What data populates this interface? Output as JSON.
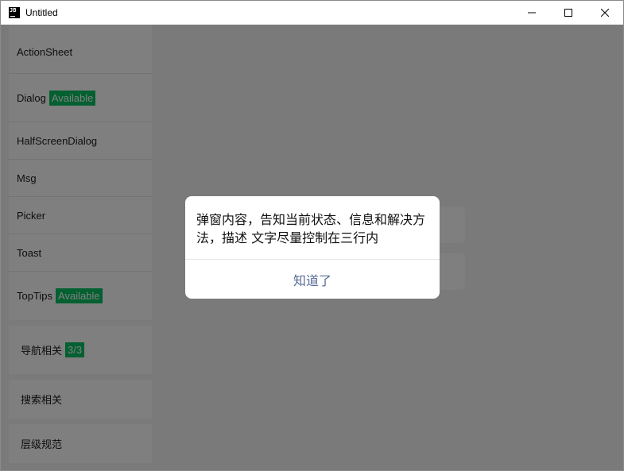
{
  "window": {
    "title": "Untitled",
    "app_icon_text": "JB"
  },
  "controls": {
    "minimize": "minimize-icon",
    "maximize": "maximize-icon",
    "close": "close-icon"
  },
  "sidebar": {
    "items": [
      {
        "label": "ActionSheet",
        "badge": ""
      },
      {
        "label": "Dialog",
        "badge": "Available"
      },
      {
        "label": "HalfScreenDialog",
        "badge": ""
      },
      {
        "label": "Msg",
        "badge": ""
      },
      {
        "label": "Picker",
        "badge": ""
      },
      {
        "label": "Toast",
        "badge": ""
      },
      {
        "label": "TopTips",
        "badge": "Available"
      }
    ],
    "nav": [
      {
        "label": "导航相关",
        "badge": "3/3"
      },
      {
        "label": "搜索相关",
        "badge": ""
      },
      {
        "label": "层级规范",
        "badge": ""
      }
    ]
  },
  "dialog": {
    "content": "弹窗内容，告知当前状态、信息和解决方法，描述 文字尽量控制在三行内",
    "confirm": "知道了"
  },
  "colors": {
    "badge": "#07c160",
    "link": "#576b95",
    "mask": "rgba(0,0,0,0.5)"
  }
}
